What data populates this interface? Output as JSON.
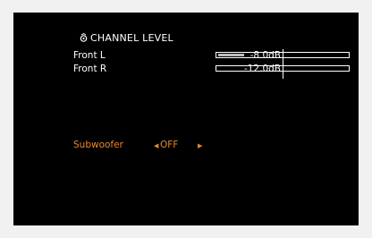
{
  "menu": {
    "title": "CHANNEL LEVEL",
    "icon": "speaker-level-icon"
  },
  "channels": [
    {
      "label": "Front L",
      "value": "-8.0dB",
      "level_fraction": 0.2
    },
    {
      "label": "Front R",
      "value": "-12.0dB",
      "level_fraction": 0.0
    }
  ],
  "subwoofer": {
    "label": "Subwoofer",
    "value": "OFF",
    "left_arrow": "◀",
    "right_arrow": "▶"
  },
  "colors": {
    "background": "#000000",
    "text": "#ffffff",
    "highlight": "#e6892e",
    "meter_fill": "#bdbdbd"
  }
}
